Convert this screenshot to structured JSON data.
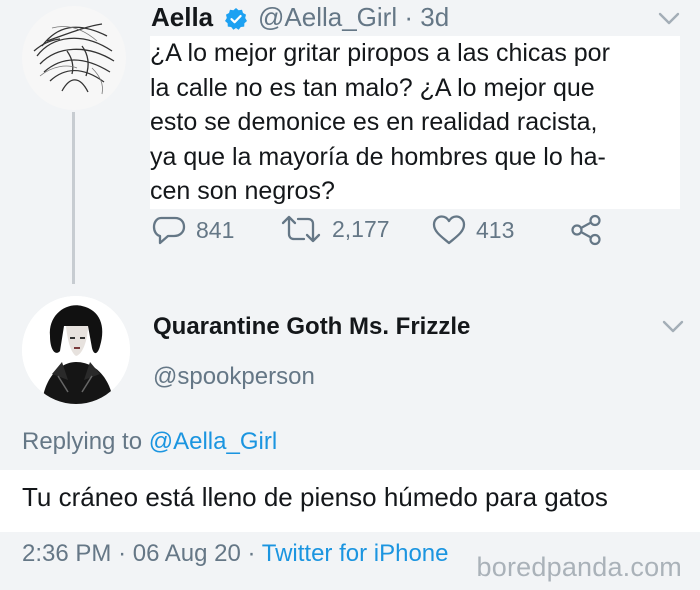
{
  "tweet": {
    "author_name": "Aella",
    "handle": "@Aella_Girl",
    "separator": "·",
    "age": "3d",
    "text": "¿A lo mejor gritar piropos a las chicas por\nla calle no es tan malo? ¿A lo mejor que\nesto se demonice es en realidad racista,\nya que la mayoría de hombres que lo ha-\ncen son negros?",
    "replies": "841",
    "retweets": "2,177",
    "likes": "413",
    "icons": [
      "verified-badge-icon",
      "chevron-down-icon",
      "reply-icon",
      "retweet-icon",
      "like-icon",
      "share-icon"
    ],
    "colors": {
      "verified": "#1da1f2",
      "muted": "#657786"
    }
  },
  "reply": {
    "author_name": "Quarantine Goth Ms. Frizzle",
    "handle": "@spookperson",
    "replying_prefix": "Replying to",
    "replying_to": "@Aella_Girl",
    "text": "Tu cráneo está lleno de pienso húmedo para gatos",
    "time": "2:36 PM",
    "separator": "·",
    "date": "06 Aug 20",
    "source": "Twitter for iPhone",
    "colors": {
      "link": "#1b95e0"
    }
  },
  "watermark": "boredpanda.com"
}
